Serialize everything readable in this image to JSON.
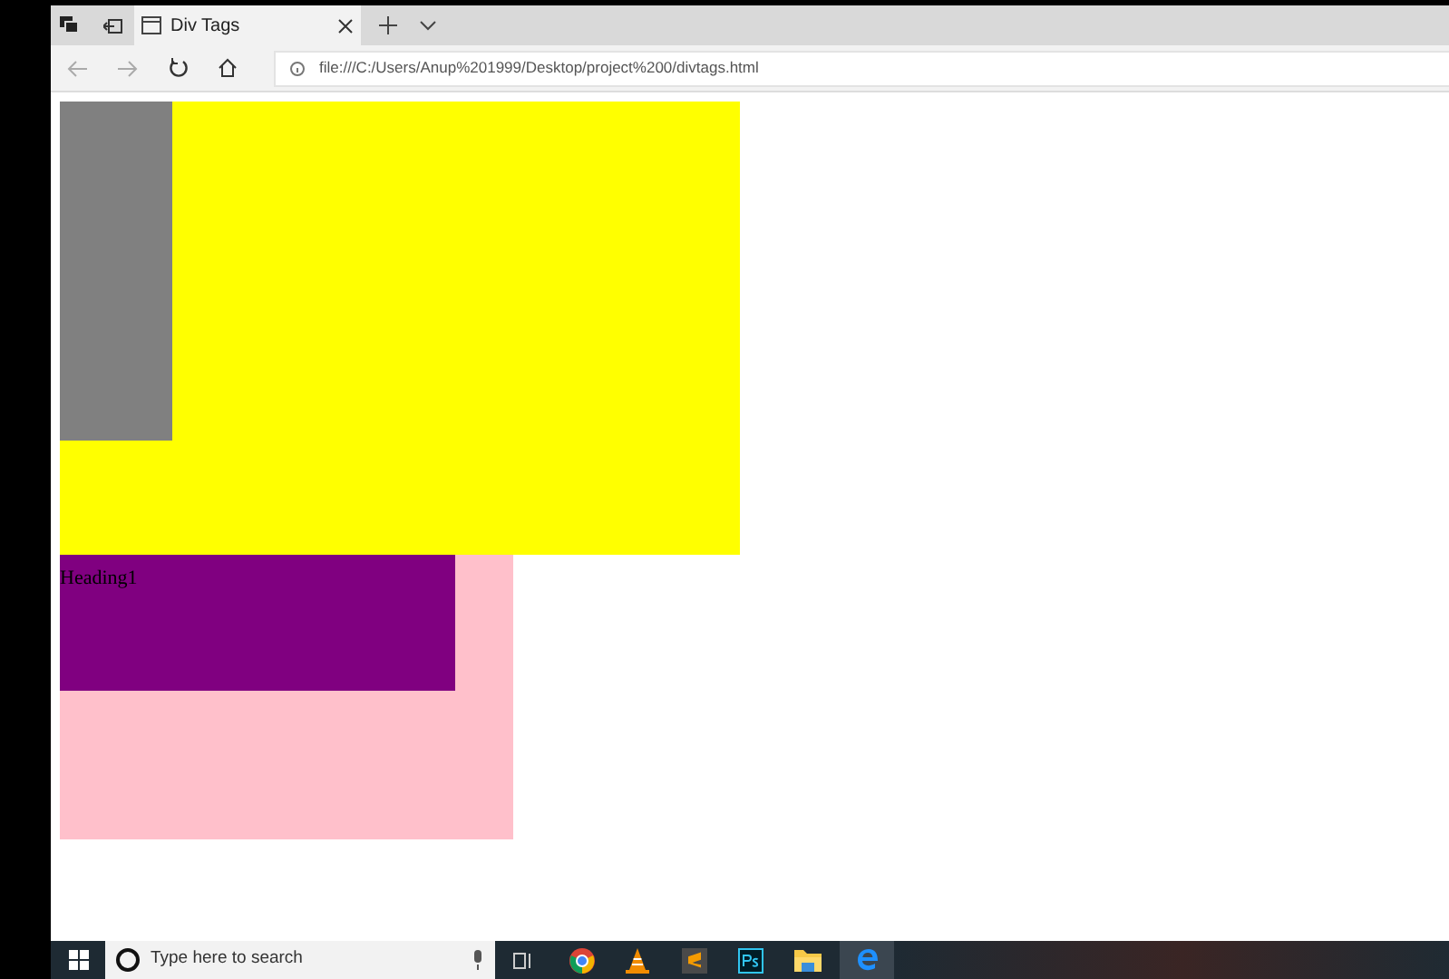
{
  "tab": {
    "title": "Div Tags",
    "selected": true
  },
  "address_bar": {
    "url": "file:///C:/Users/Anup%201999/Desktop/project%200/divtags.html"
  },
  "page": {
    "heading": "Heading1"
  },
  "taskbar": {
    "search_placeholder": "Type here to search"
  }
}
